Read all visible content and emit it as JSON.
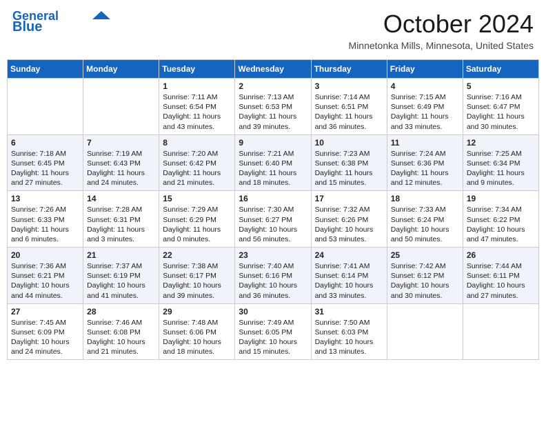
{
  "header": {
    "logo_line1": "General",
    "logo_line2": "Blue",
    "month": "October 2024",
    "location": "Minnetonka Mills, Minnesota, United States"
  },
  "days_of_week": [
    "Sunday",
    "Monday",
    "Tuesday",
    "Wednesday",
    "Thursday",
    "Friday",
    "Saturday"
  ],
  "weeks": [
    [
      {
        "day": "",
        "content": ""
      },
      {
        "day": "",
        "content": ""
      },
      {
        "day": "1",
        "content": "Sunrise: 7:11 AM\nSunset: 6:54 PM\nDaylight: 11 hours and 43 minutes."
      },
      {
        "day": "2",
        "content": "Sunrise: 7:13 AM\nSunset: 6:53 PM\nDaylight: 11 hours and 39 minutes."
      },
      {
        "day": "3",
        "content": "Sunrise: 7:14 AM\nSunset: 6:51 PM\nDaylight: 11 hours and 36 minutes."
      },
      {
        "day": "4",
        "content": "Sunrise: 7:15 AM\nSunset: 6:49 PM\nDaylight: 11 hours and 33 minutes."
      },
      {
        "day": "5",
        "content": "Sunrise: 7:16 AM\nSunset: 6:47 PM\nDaylight: 11 hours and 30 minutes."
      }
    ],
    [
      {
        "day": "6",
        "content": "Sunrise: 7:18 AM\nSunset: 6:45 PM\nDaylight: 11 hours and 27 minutes."
      },
      {
        "day": "7",
        "content": "Sunrise: 7:19 AM\nSunset: 6:43 PM\nDaylight: 11 hours and 24 minutes."
      },
      {
        "day": "8",
        "content": "Sunrise: 7:20 AM\nSunset: 6:42 PM\nDaylight: 11 hours and 21 minutes."
      },
      {
        "day": "9",
        "content": "Sunrise: 7:21 AM\nSunset: 6:40 PM\nDaylight: 11 hours and 18 minutes."
      },
      {
        "day": "10",
        "content": "Sunrise: 7:23 AM\nSunset: 6:38 PM\nDaylight: 11 hours and 15 minutes."
      },
      {
        "day": "11",
        "content": "Sunrise: 7:24 AM\nSunset: 6:36 PM\nDaylight: 11 hours and 12 minutes."
      },
      {
        "day": "12",
        "content": "Sunrise: 7:25 AM\nSunset: 6:34 PM\nDaylight: 11 hours and 9 minutes."
      }
    ],
    [
      {
        "day": "13",
        "content": "Sunrise: 7:26 AM\nSunset: 6:33 PM\nDaylight: 11 hours and 6 minutes."
      },
      {
        "day": "14",
        "content": "Sunrise: 7:28 AM\nSunset: 6:31 PM\nDaylight: 11 hours and 3 minutes."
      },
      {
        "day": "15",
        "content": "Sunrise: 7:29 AM\nSunset: 6:29 PM\nDaylight: 11 hours and 0 minutes."
      },
      {
        "day": "16",
        "content": "Sunrise: 7:30 AM\nSunset: 6:27 PM\nDaylight: 10 hours and 56 minutes."
      },
      {
        "day": "17",
        "content": "Sunrise: 7:32 AM\nSunset: 6:26 PM\nDaylight: 10 hours and 53 minutes."
      },
      {
        "day": "18",
        "content": "Sunrise: 7:33 AM\nSunset: 6:24 PM\nDaylight: 10 hours and 50 minutes."
      },
      {
        "day": "19",
        "content": "Sunrise: 7:34 AM\nSunset: 6:22 PM\nDaylight: 10 hours and 47 minutes."
      }
    ],
    [
      {
        "day": "20",
        "content": "Sunrise: 7:36 AM\nSunset: 6:21 PM\nDaylight: 10 hours and 44 minutes."
      },
      {
        "day": "21",
        "content": "Sunrise: 7:37 AM\nSunset: 6:19 PM\nDaylight: 10 hours and 41 minutes."
      },
      {
        "day": "22",
        "content": "Sunrise: 7:38 AM\nSunset: 6:17 PM\nDaylight: 10 hours and 39 minutes."
      },
      {
        "day": "23",
        "content": "Sunrise: 7:40 AM\nSunset: 6:16 PM\nDaylight: 10 hours and 36 minutes."
      },
      {
        "day": "24",
        "content": "Sunrise: 7:41 AM\nSunset: 6:14 PM\nDaylight: 10 hours and 33 minutes."
      },
      {
        "day": "25",
        "content": "Sunrise: 7:42 AM\nSunset: 6:12 PM\nDaylight: 10 hours and 30 minutes."
      },
      {
        "day": "26",
        "content": "Sunrise: 7:44 AM\nSunset: 6:11 PM\nDaylight: 10 hours and 27 minutes."
      }
    ],
    [
      {
        "day": "27",
        "content": "Sunrise: 7:45 AM\nSunset: 6:09 PM\nDaylight: 10 hours and 24 minutes."
      },
      {
        "day": "28",
        "content": "Sunrise: 7:46 AM\nSunset: 6:08 PM\nDaylight: 10 hours and 21 minutes."
      },
      {
        "day": "29",
        "content": "Sunrise: 7:48 AM\nSunset: 6:06 PM\nDaylight: 10 hours and 18 minutes."
      },
      {
        "day": "30",
        "content": "Sunrise: 7:49 AM\nSunset: 6:05 PM\nDaylight: 10 hours and 15 minutes."
      },
      {
        "day": "31",
        "content": "Sunrise: 7:50 AM\nSunset: 6:03 PM\nDaylight: 10 hours and 13 minutes."
      },
      {
        "day": "",
        "content": ""
      },
      {
        "day": "",
        "content": ""
      }
    ]
  ]
}
